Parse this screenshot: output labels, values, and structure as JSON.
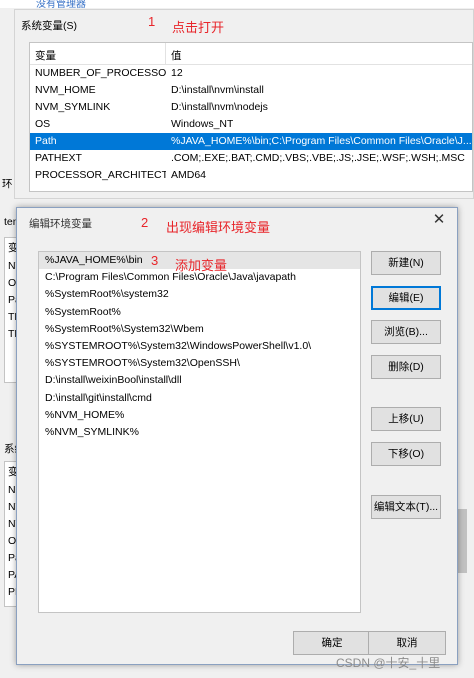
{
  "background": {
    "top_fragment": "没有管理器",
    "system_vars_title": "系统变量(S)",
    "columns": [
      "变量",
      "值"
    ],
    "rows": [
      {
        "name": "NUMBER_OF_PROCESSORS",
        "value": "12",
        "selected": false
      },
      {
        "name": "NVM_HOME",
        "value": "D:\\install\\nvm\\install",
        "selected": false
      },
      {
        "name": "NVM_SYMLINK",
        "value": "D:\\install\\nvm\\nodejs",
        "selected": false
      },
      {
        "name": "OS",
        "value": "Windows_NT",
        "selected": false
      },
      {
        "name": "Path",
        "value": "%JAVA_HOME%\\bin;C:\\Program Files\\Common Files\\Oracle\\J...",
        "selected": true
      },
      {
        "name": "PATHEXT",
        "value": ".COM;.EXE;.BAT;.CMD;.VBS;.VBE;.JS;.JSE;.WSF;.WSH;.MSC",
        "selected": false
      },
      {
        "name": "PROCESSOR_ARCHITECT...",
        "value": "AMD64",
        "selected": false
      }
    ],
    "left_fragments": {
      "env_user": "tenA",
      "user_items": [
        "变",
        "NV",
        "O",
        "Pa",
        "TE",
        "TM"
      ],
      "sys_label": "系统",
      "sys_items": [
        "变",
        "NU",
        "NV",
        "NV",
        "OS",
        "Pa",
        "PA",
        "PR"
      ]
    }
  },
  "annotations": {
    "step1_num": "1",
    "step1_text": "点击打开",
    "step2_num": "2",
    "step2_text": "出现编辑环境变量",
    "step3_num": "3",
    "step3_text": "添加变量"
  },
  "edit_dialog": {
    "title": "编辑环境变量",
    "close": "✕",
    "paths": [
      "%JAVA_HOME%\\bin",
      "C:\\Program Files\\Common Files\\Oracle\\Java\\javapath",
      "%SystemRoot%\\system32",
      "%SystemRoot%",
      "%SystemRoot%\\System32\\Wbem",
      "%SYSTEMROOT%\\System32\\WindowsPowerShell\\v1.0\\",
      "%SYSTEMROOT%\\System32\\OpenSSH\\",
      "D:\\install\\weixinBool\\install\\dll",
      "D:\\install\\git\\install\\cmd",
      "%NVM_HOME%",
      "%NVM_SYMLINK%"
    ],
    "selected_index": 0,
    "buttons": {
      "new": "新建(N)",
      "edit": "编辑(E)",
      "browse": "浏览(B)...",
      "delete": "删除(D)",
      "move_up": "上移(U)",
      "move_down": "下移(O)",
      "edit_text": "编辑文本(T)..."
    },
    "ok": "确定",
    "cancel": "取消"
  },
  "watermark": "CSDN @十安_十里"
}
